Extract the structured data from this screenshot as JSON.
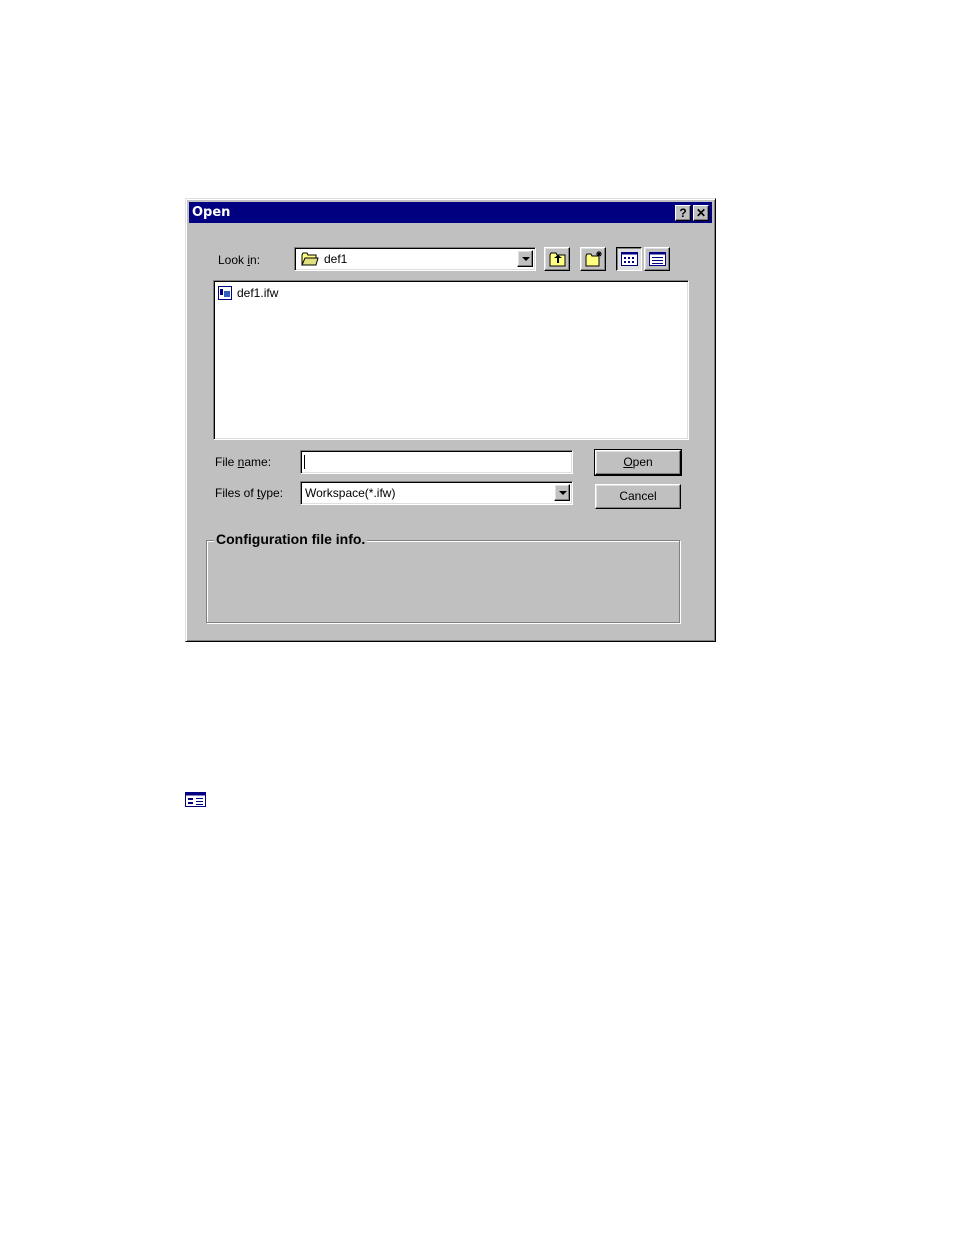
{
  "dialog": {
    "title": "Open",
    "help_button": "?",
    "close_button": "✕"
  },
  "look_in": {
    "label_pre": "Look ",
    "label_u": "i",
    "label_post": "n:",
    "value": "def1"
  },
  "toolbar": {
    "up_folder": "up-one-level",
    "new_folder": "create-new-folder",
    "list_view": "list",
    "details_view": "details"
  },
  "files": [
    {
      "name": "def1.ifw",
      "icon": "workspace-file-icon"
    }
  ],
  "file_name": {
    "label_pre": "File ",
    "label_u": "n",
    "label_post": "ame:",
    "value": ""
  },
  "file_type": {
    "label_pre": "Files of ",
    "label_u": "t",
    "label_post": "ype:",
    "value": "Workspace(*.ifw)"
  },
  "buttons": {
    "open_u": "O",
    "open_rest": "pen",
    "cancel": "Cancel"
  },
  "config_group": {
    "title": "Configuration file info."
  }
}
